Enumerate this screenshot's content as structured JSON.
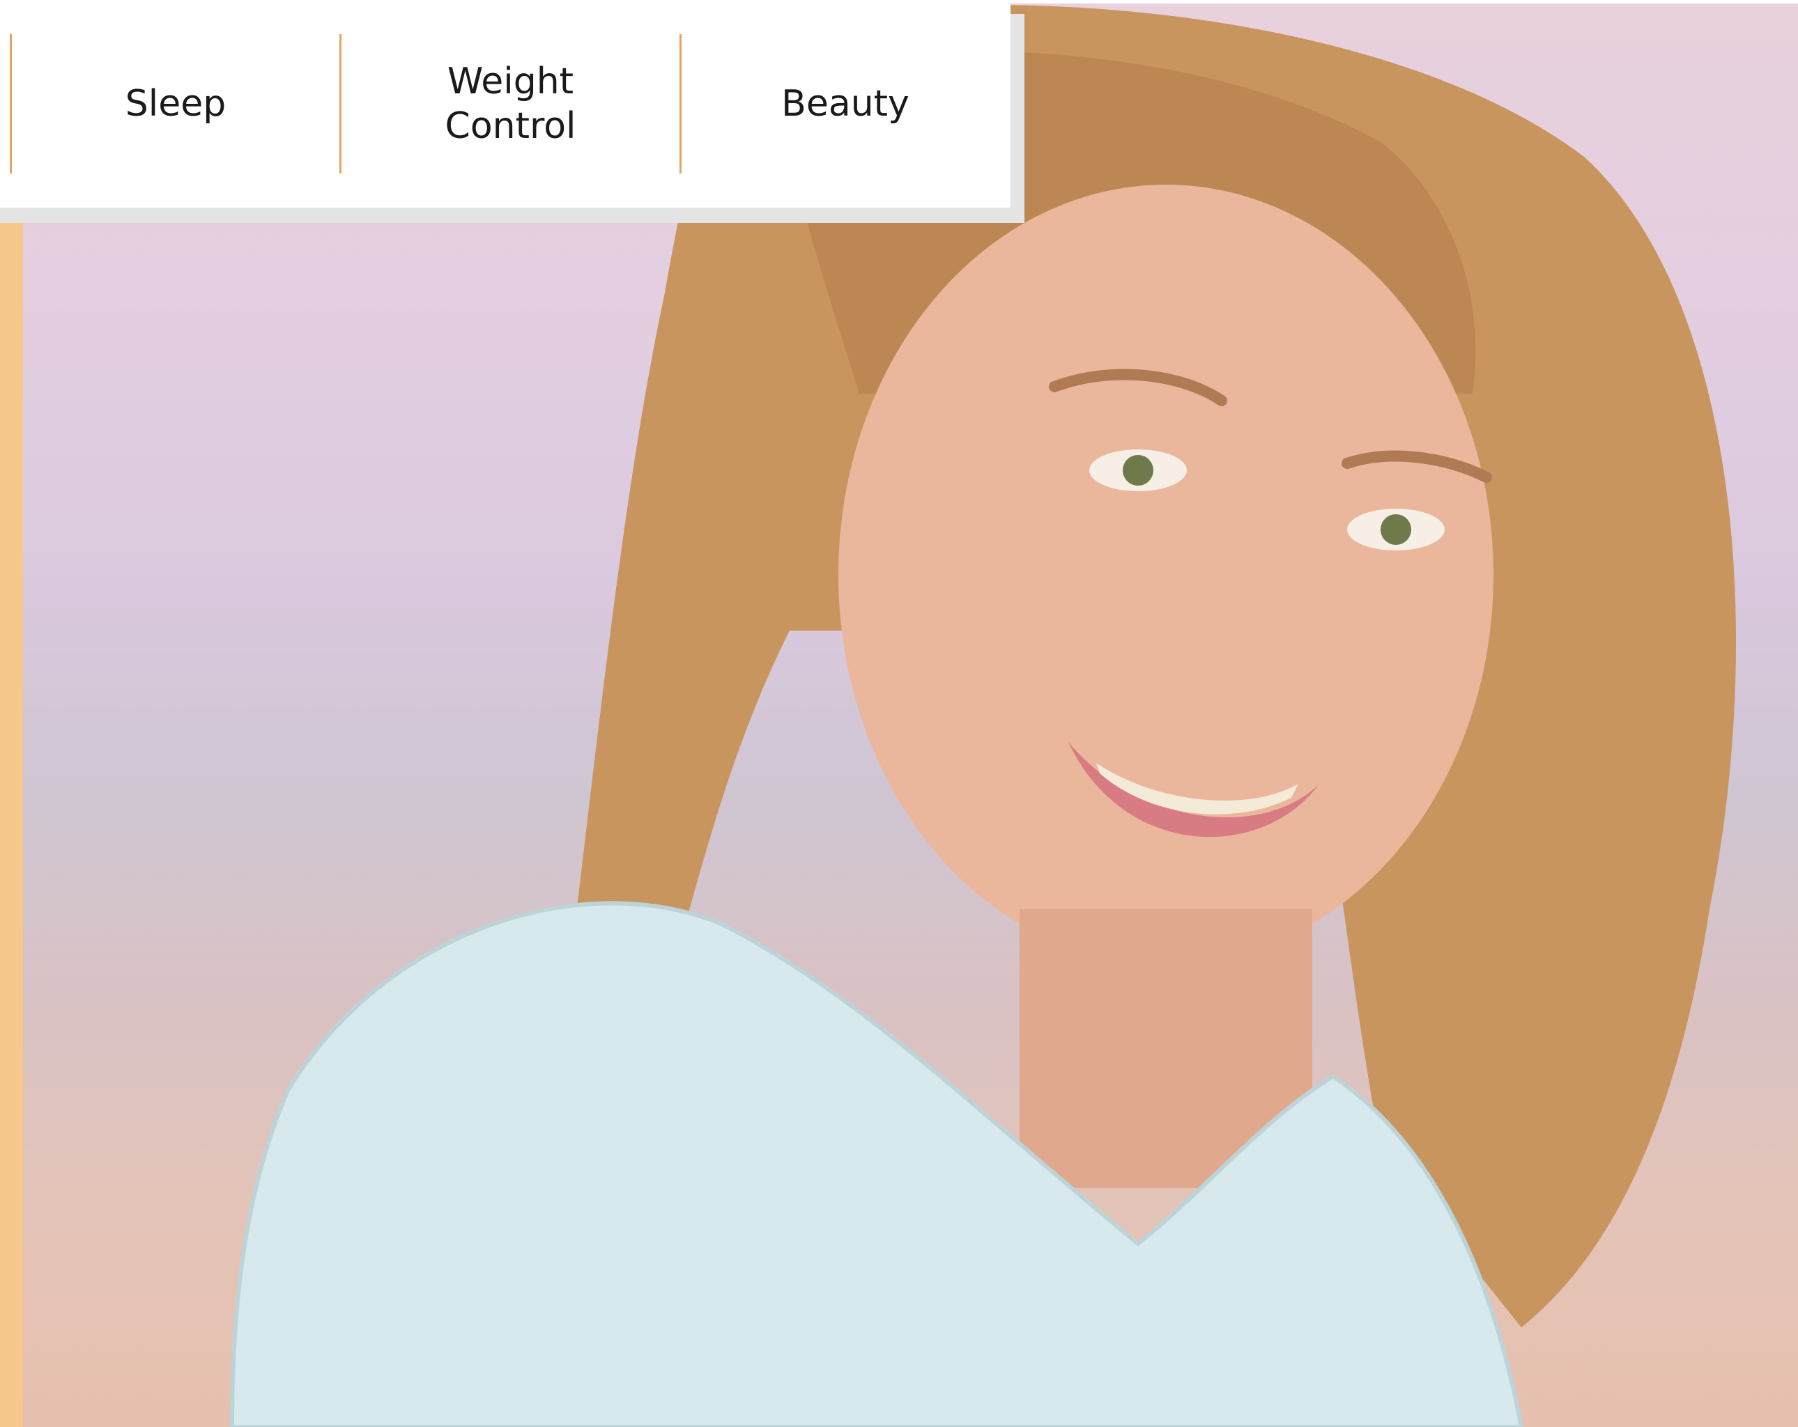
{
  "nav": {
    "items": [
      {
        "label": "Sleep"
      },
      {
        "label": "Weight Control"
      },
      {
        "label": "Beauty"
      }
    ]
  },
  "colors": {
    "accent": "#f6c88c",
    "divider": "#e4a460",
    "nav_text": "#1a1a1a"
  }
}
